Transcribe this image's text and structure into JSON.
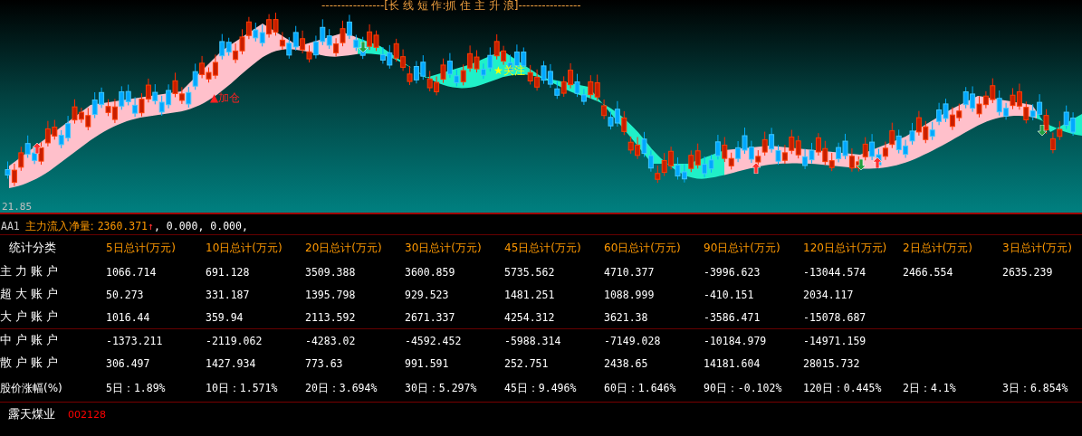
{
  "chart": {
    "title": "----------------[长 线 短 作:抓 住 主 升 浪]----------------",
    "low_label": "21.85",
    "signals": [
      {
        "kind": "add",
        "text": "▲加仓"
      },
      {
        "kind": "watch",
        "text": "★关注"
      }
    ]
  },
  "formula": {
    "name": "AA1",
    "label": "主力流入净量:",
    "value": "2360.371",
    "arrow": "↑",
    "rest": ", 0.000, 0.000,"
  },
  "table": {
    "header": "统计分类",
    "columns": [
      "5日总计(万元)",
      "10日总计(万元)",
      "20日总计(万元)",
      "30日总计(万元)",
      "45日总计(万元)",
      "60日总计(万元)",
      "90日总计(万元)",
      "120日总计(万元)",
      "2日总计(万元)",
      "3日总计(万元)"
    ],
    "rows": [
      {
        "label": "主 力 账 户",
        "cells": [
          "1066.714",
          "691.128",
          "3509.388",
          "3600.859",
          "5735.562",
          "4710.377",
          "-3996.623",
          "-13044.574",
          "2466.554",
          "2635.239"
        ]
      },
      {
        "label": "超 大 账 户",
        "cells": [
          "50.273",
          "331.187",
          "1395.798",
          "929.523",
          "1481.251",
          "1088.999",
          "-410.151",
          "2034.117"
        ]
      },
      {
        "label": "大 户 账 户",
        "cells": [
          "1016.44",
          "359.94",
          "2113.592",
          "2671.337",
          "4254.312",
          "3621.38",
          "-3586.471",
          "-15078.687"
        ]
      },
      {
        "label": "中 户 账 户",
        "cells": [
          "-1373.211",
          "-2119.062",
          "-4283.02",
          "-4592.452",
          "-5988.314",
          "-7149.028",
          "-10184.979",
          "-14971.159"
        ]
      },
      {
        "label": "散 户 账 户",
        "cells": [
          "306.497",
          "1427.934",
          "773.63",
          "991.591",
          "252.751",
          "2438.65",
          "14181.604",
          "28015.732"
        ]
      }
    ],
    "change": {
      "label": "股价涨幅(%)",
      "cells": [
        "5日：1.89%",
        "10日：1.571%",
        "20日：3.694%",
        "30日：5.297%",
        "45日：9.496%",
        "60日：1.646%",
        "90日：-0.102%",
        "120日：0.445%",
        "2日：4.1%",
        "3日：6.854%"
      ]
    }
  },
  "stock": {
    "name": "露天煤业",
    "code": "002128"
  }
}
